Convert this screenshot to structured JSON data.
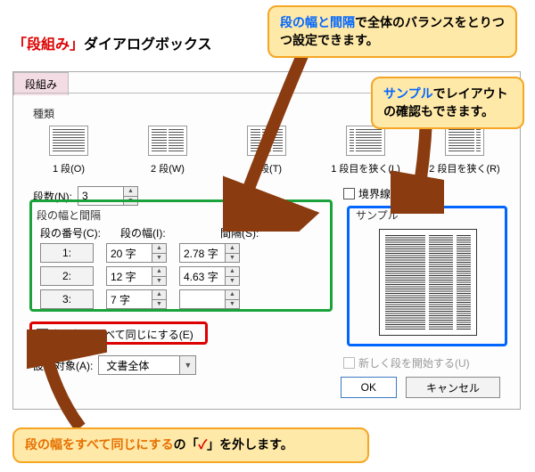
{
  "title": {
    "quoted": "「段組み」",
    "rest": "ダイアログボックス"
  },
  "callouts": {
    "top": {
      "blue": "段の幅と間隔",
      "rest": "で全体のバランスをとりつつ設定できます。"
    },
    "right": {
      "blue": "サンプル",
      "rest": "でレイアウトの確認もできます。"
    },
    "bottom": {
      "orange": "段の幅をすべて同じにする",
      "mid": "の「",
      "red": "✓",
      "end": "」を外します。"
    }
  },
  "dialog": {
    "tab": "段組み",
    "kind_label": "種類",
    "presets": [
      {
        "label": "1 段(O)",
        "cols": 1
      },
      {
        "label": "2 段(W)",
        "cols": 2
      },
      {
        "label": "3 段(T)",
        "cols": 3
      },
      {
        "label": "1 段目を狭く(L)",
        "cols": 2
      },
      {
        "label": "2 段目を狭く(R)",
        "cols": 2
      }
    ],
    "count_label": "段数(N):",
    "count_value": "3",
    "border_label": "境界線を引く(B)",
    "widths_group": "段の幅と間隔",
    "col_num": "段の番号(C):",
    "col_width": "段の幅(I):",
    "col_gap": "間隔(S):",
    "rows": [
      {
        "num": "1:",
        "width": "20 字",
        "gap": "2.78 字"
      },
      {
        "num": "2:",
        "width": "12 字",
        "gap": "4.63 字"
      },
      {
        "num": "3:",
        "width": "7 字",
        "gap": ""
      }
    ],
    "equal_label": "段の幅をすべて同じにする(E)",
    "sample_label": "サンプル",
    "apply_label": "設定対象(A):",
    "apply_value": "文書全体",
    "newcol_label": "新しく段を開始する(U)",
    "ok": "OK",
    "cancel": "キャンセル"
  }
}
